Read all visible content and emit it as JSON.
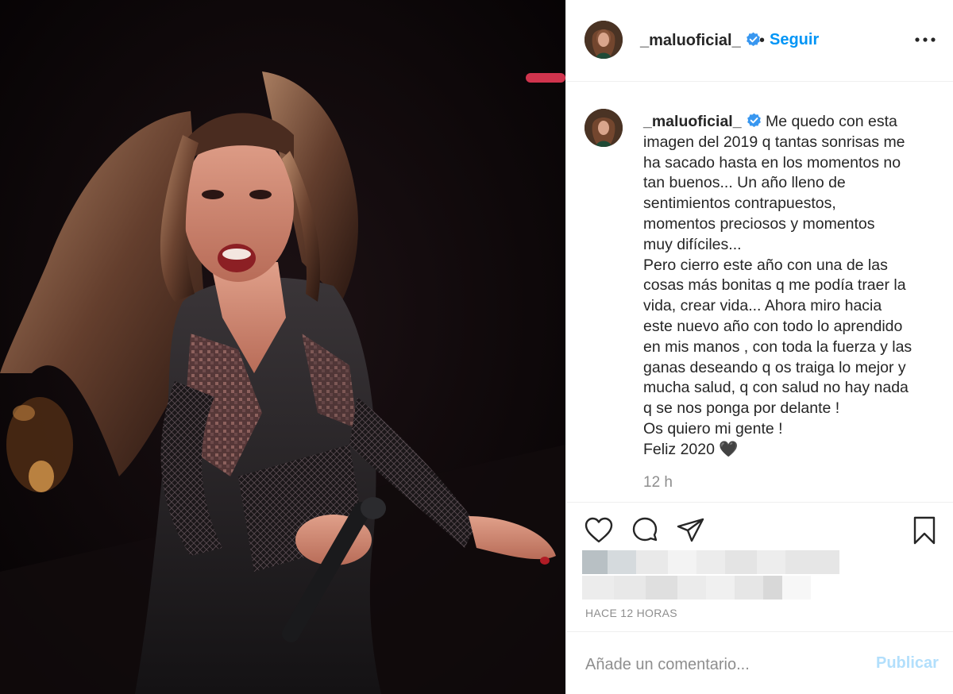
{
  "post": {
    "username": "_maluoficial_",
    "follow_label": "Seguir",
    "dot_separator": "•",
    "caption_lines": [
      "Me quedo con esta",
      "imagen del 2019 q tantas sonrisas me",
      "ha sacado hasta en los momentos no",
      "tan buenos... Un año lleno de",
      "sentimientos contrapuestos,",
      "momentos preciosos y momentos",
      "muy difíciles...",
      "Pero cierro este año con una de las",
      "cosas más bonitas q me podía traer la",
      "vida, crear vida... Ahora miro hacia",
      "este nuevo año con todo lo aprendido",
      "en mis manos , con toda la fuerza y las",
      "ganas deseando q os traiga lo mejor y",
      "mucha salud, q con salud no hay nada",
      "q se nos ponga por delante !",
      "Os quiero mi gente !",
      "Feliz 2020 🖤"
    ],
    "timestamp": "12 h",
    "time_ago": "HACE 12 HORAS"
  },
  "comment": {
    "placeholder": "Añade un comentario...",
    "publish_label": "Publicar"
  },
  "icons": {
    "verified": "verified-badge-icon",
    "more": "more-options-icon",
    "like": "heart-icon",
    "comment": "comment-bubble-icon",
    "share": "paper-plane-icon",
    "save": "bookmark-icon"
  },
  "colors": {
    "link_blue": "#0095f6",
    "publish_disabled": "#b2dffc",
    "muted_text": "#8e8e8e",
    "border": "#efefef",
    "text": "#262626"
  }
}
